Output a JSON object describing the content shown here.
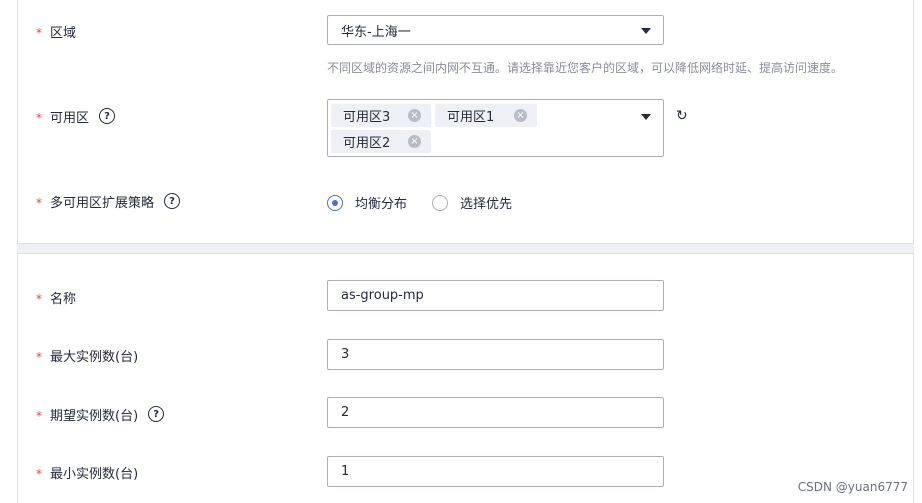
{
  "region": {
    "label": "区域",
    "value": "华东-上海一",
    "hint": "不同区域的资源之间内网不互通。请选择靠近您客户的区域，可以降低网络时延、提高访问速度。"
  },
  "az": {
    "label": "可用区",
    "help": "?",
    "tags": [
      "可用区3",
      "可用区1",
      "可用区2"
    ],
    "remove_icon": "×",
    "refresh_icon": "↻"
  },
  "policy": {
    "label": "多可用区扩展策略",
    "help": "?",
    "options": [
      "均衡分布",
      "选择优先"
    ],
    "selected": "均衡分布"
  },
  "name": {
    "label": "名称",
    "value": "as-group-mp"
  },
  "max_instances": {
    "label": "最大实例数(台)",
    "value": "3"
  },
  "desired_instances": {
    "label": "期望实例数(台)",
    "help": "?",
    "value": "2"
  },
  "min_instances": {
    "label": "最小实例数(台)",
    "value": "1"
  },
  "required_mark": "*",
  "watermark": "CSDN @yuan6777",
  "colors": {
    "accent": "#526ecc",
    "required": "#e54545",
    "hint": "#8a8e99"
  }
}
